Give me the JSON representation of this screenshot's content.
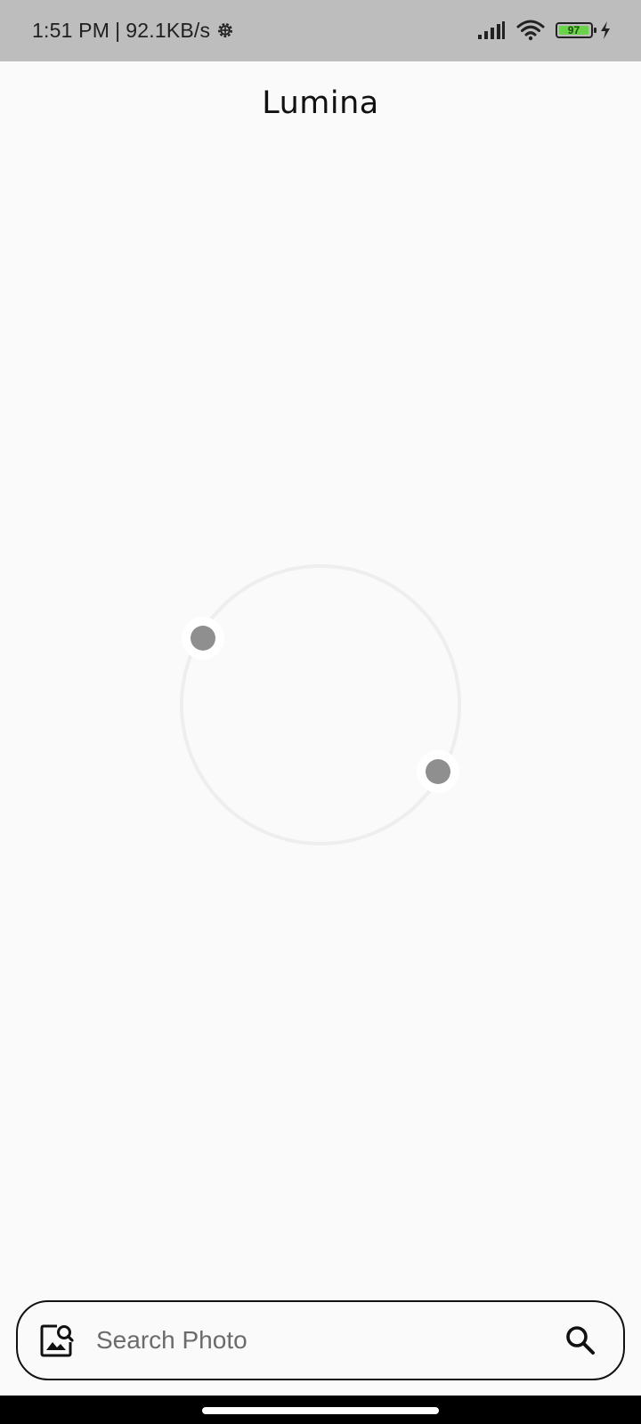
{
  "status_bar": {
    "time": "1:51 PM",
    "separator": "|",
    "network_speed": "92.1KB/s",
    "battery_level": "97",
    "icons": [
      "settings-gear-icon",
      "signal-icon",
      "wifi-icon",
      "battery-icon",
      "charging-bolt-icon"
    ]
  },
  "app": {
    "title": "Lumina"
  },
  "search": {
    "placeholder": "Search Photo",
    "value": "",
    "leading_icon": "image-search-icon",
    "trailing_icon": "search-icon"
  },
  "colors": {
    "status_bar_bg": "#bdbdbd",
    "background": "#fafafa",
    "battery_fill": "#6bd34a",
    "loader_dot": "#8f8f8f",
    "loader_ring": "#eeeeee",
    "nav_bar": "#000000"
  }
}
